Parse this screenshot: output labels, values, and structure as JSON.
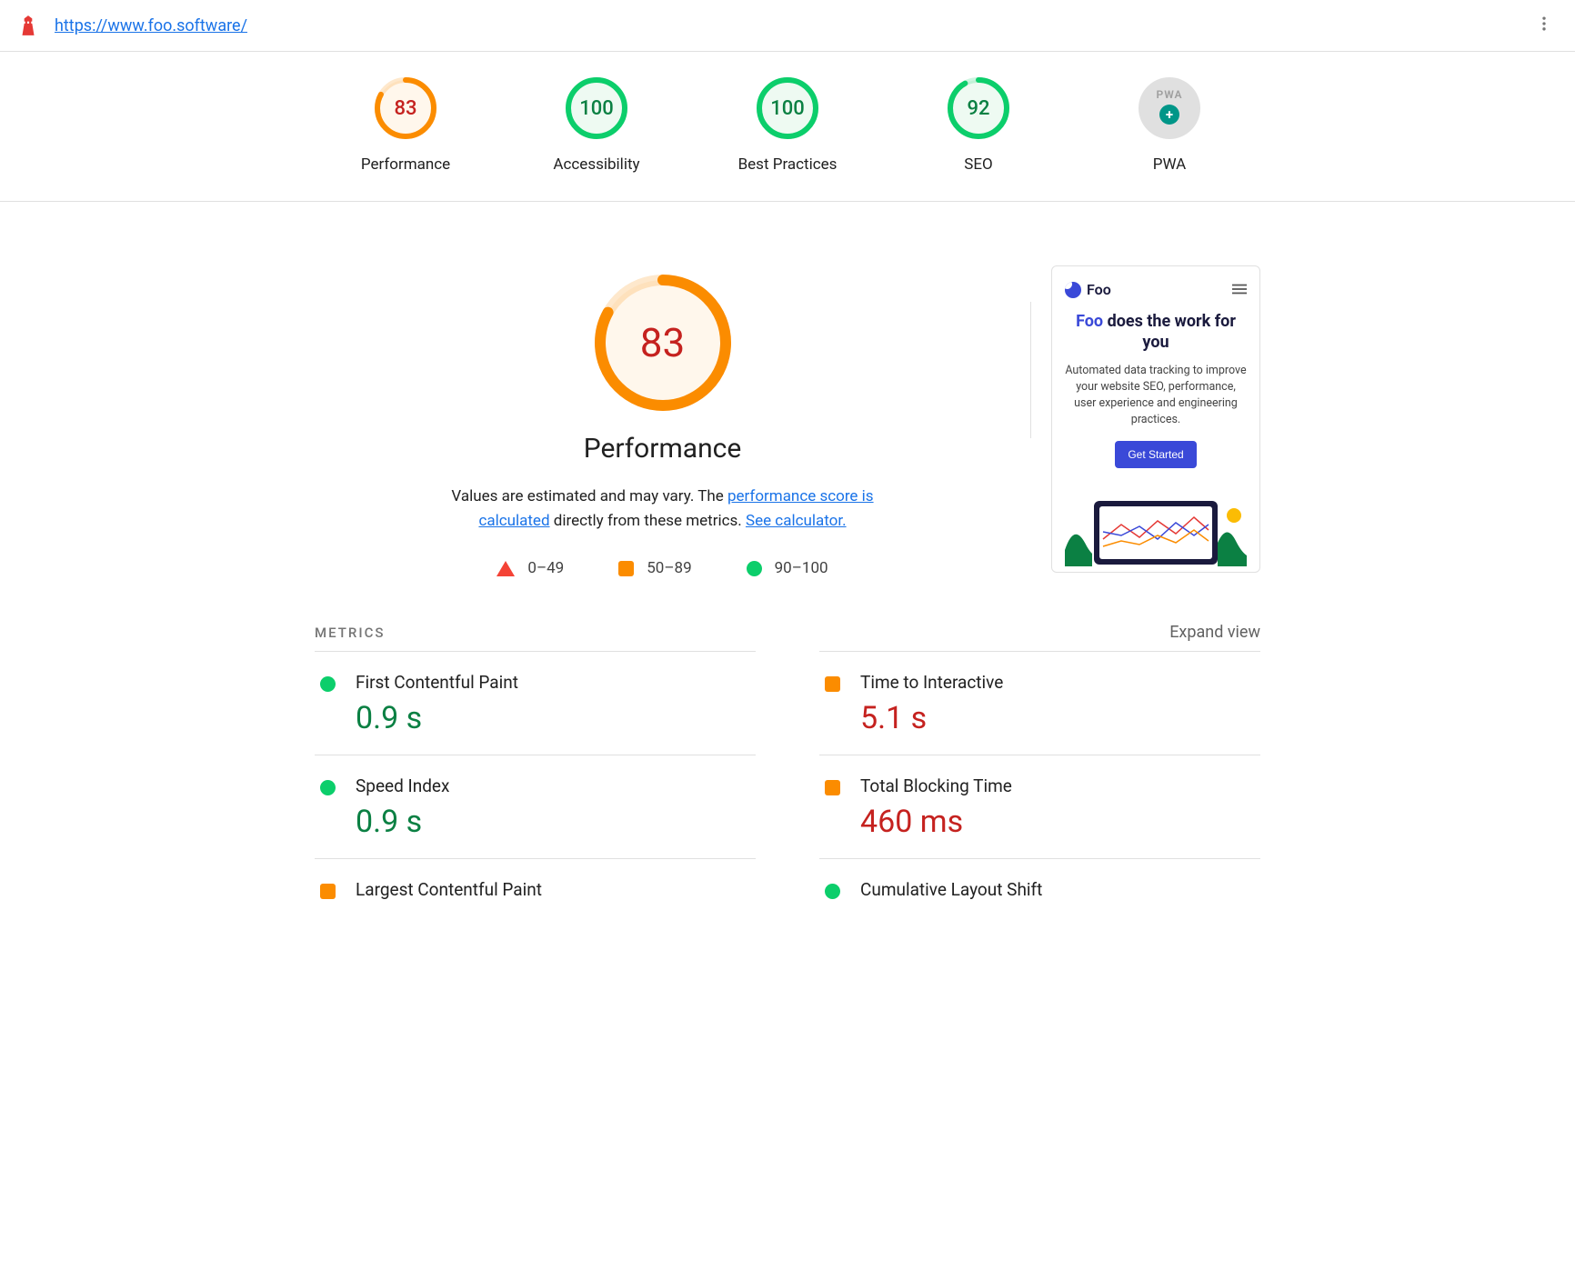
{
  "url": "https://www.foo.software/",
  "colors": {
    "pass": "#0cce6b",
    "avg": "#fb8c00",
    "fail": "#f44336",
    "passText": "#0b8043",
    "avgText": "#c5221f"
  },
  "categories": [
    {
      "id": "performance",
      "label": "Performance",
      "score": 83,
      "color": "#fb8c00",
      "bg": "#fff7ec",
      "text": "#c5221f"
    },
    {
      "id": "accessibility",
      "label": "Accessibility",
      "score": 100,
      "color": "#0cce6b",
      "bg": "#eefaf2",
      "text": "#0b8043"
    },
    {
      "id": "best-practices",
      "label": "Best Practices",
      "score": 100,
      "color": "#0cce6b",
      "bg": "#eefaf2",
      "text": "#0b8043"
    },
    {
      "id": "seo",
      "label": "SEO",
      "score": 92,
      "color": "#0cce6b",
      "bg": "#eefaf2",
      "text": "#0b8043"
    },
    {
      "id": "pwa",
      "label": "PWA",
      "pwa": true
    }
  ],
  "big": {
    "score": 83,
    "color": "#fb8c00",
    "bg": "#fff7ec",
    "text": "#c5221f",
    "title": "Performance"
  },
  "desc": {
    "pre": "Values are estimated and may vary. The ",
    "link1": "performance score is calculated",
    "mid": " directly from these metrics. ",
    "link2": "See calculator."
  },
  "legend": [
    {
      "shape": "tri",
      "label": "0–49"
    },
    {
      "shape": "sq",
      "label": "50–89"
    },
    {
      "shape": "circ",
      "label": "90–100"
    }
  ],
  "preview": {
    "brand": "Foo",
    "headline_prefix": "Foo",
    "headline_rest": " does the work for you",
    "sub": "Automated data tracking to improve your website SEO, performance, user experience and engineering practices.",
    "cta": "Get Started"
  },
  "metricsTitle": "METRICS",
  "expandLabel": "Expand view",
  "metrics": [
    {
      "name": "First Contentful Paint",
      "value": "0.9 s",
      "status": "pass"
    },
    {
      "name": "Time to Interactive",
      "value": "5.1 s",
      "status": "avg"
    },
    {
      "name": "Speed Index",
      "value": "0.9 s",
      "status": "pass"
    },
    {
      "name": "Total Blocking Time",
      "value": "460 ms",
      "status": "avg"
    },
    {
      "name": "Largest Contentful Paint",
      "value": "",
      "status": "avg-sq"
    },
    {
      "name": "Cumulative Layout Shift",
      "value": "",
      "status": "pass"
    }
  ]
}
